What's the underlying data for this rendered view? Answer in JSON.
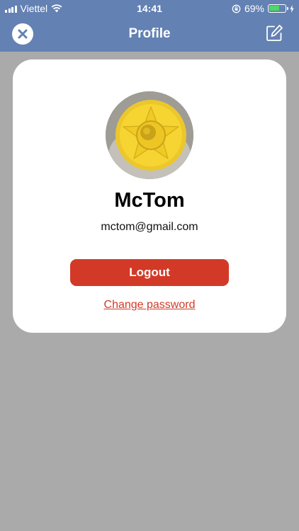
{
  "status_bar": {
    "carrier": "Viettel",
    "time": "14:41",
    "battery_percent": "69%",
    "battery_level": 0.69
  },
  "header": {
    "title": "Profile",
    "close_icon": "close-icon",
    "edit_icon": "edit-icon"
  },
  "profile": {
    "name": "McTom",
    "email": "mctom@gmail.com",
    "logout_label": "Logout",
    "change_password_label": "Change password"
  },
  "colors": {
    "header_bg": "#6381b3",
    "overlay_bg": "#aaaaaa",
    "accent_red": "#d23a27",
    "battery_green": "#4cd964"
  }
}
